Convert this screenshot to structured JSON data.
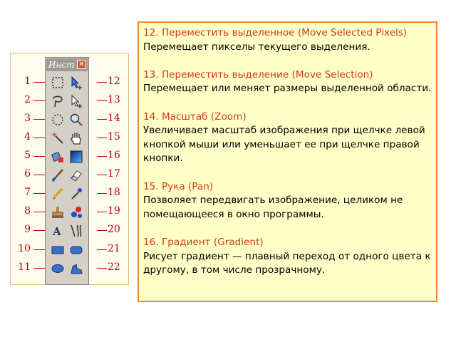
{
  "toolbox": {
    "title": "Инст",
    "close_glyph": "✕",
    "tools": [
      {
        "number": "1",
        "name": "rect-select-icon"
      },
      {
        "number": "2",
        "name": "lasso-select-icon"
      },
      {
        "number": "3",
        "name": "ellipse-select-icon"
      },
      {
        "number": "4",
        "name": "magic-wand-icon"
      },
      {
        "number": "5",
        "name": "paint-bucket-icon"
      },
      {
        "number": "6",
        "name": "paintbrush-icon"
      },
      {
        "number": "7",
        "name": "pencil-icon"
      },
      {
        "number": "8",
        "name": "clone-stamp-icon"
      },
      {
        "number": "9",
        "name": "text-icon"
      },
      {
        "number": "10",
        "name": "rectangle-icon"
      },
      {
        "number": "11",
        "name": "ellipse-icon"
      },
      {
        "number": "12",
        "name": "move-selected-pixels-icon"
      },
      {
        "number": "13",
        "name": "move-selection-icon"
      },
      {
        "number": "14",
        "name": "zoom-icon"
      },
      {
        "number": "15",
        "name": "pan-hand-icon"
      },
      {
        "number": "16",
        "name": "gradient-icon"
      },
      {
        "number": "17",
        "name": "eraser-icon"
      },
      {
        "number": "18",
        "name": "color-picker-icon"
      },
      {
        "number": "19",
        "name": "recolor-icon"
      },
      {
        "number": "20",
        "name": "line-curve-icon"
      },
      {
        "number": "21",
        "name": "rounded-rectangle-icon"
      },
      {
        "number": "22",
        "name": "freeform-shape-icon"
      }
    ]
  },
  "descriptions": [
    {
      "heading": "12. Переместить выделенное (Move Selected Pixels)",
      "text": "Перемещает пикселы текущего выделения."
    },
    {
      "heading": "13. Переместить выделение (Move Selection)",
      "text": "Перемещает или меняет размеры выделенной области."
    },
    {
      "heading": "14. Масштаб (Zoom)",
      "text": "Увеличивает масштаб изображения при щелчке левой кнопкой мыши или уменьшает ее при щелчке правой кнопки."
    },
    {
      "heading": "15. Рука (Pan)",
      "text": "Позволяет передвигать изображение, целиком не помещающееся в окно программы."
    },
    {
      "heading": "16. Градиент (Gradient)",
      "text": "Рисует градиент — плавный переход от одного цвета к другому, в том числе прозрачному."
    }
  ],
  "colors": {
    "heading": "#d03a16",
    "number_marks": "#c00000",
    "box_border": "#f08b26",
    "box_background": "#ffffc8"
  }
}
